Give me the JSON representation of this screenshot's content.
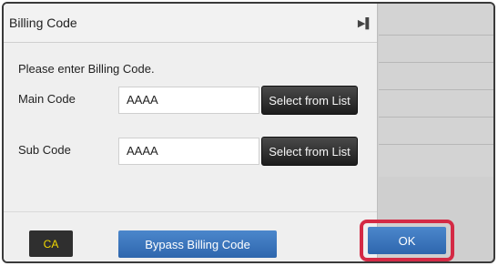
{
  "dialog": {
    "title": "Billing Code",
    "instruction": "Please enter Billing Code.",
    "main_code": {
      "label": "Main Code",
      "value": "AAAA",
      "button": "Select from List"
    },
    "sub_code": {
      "label": "Sub Code",
      "value": "AAAA",
      "button": "Select from List"
    }
  },
  "footer": {
    "ca_label": "CA",
    "bypass_label": "Bypass Billing Code",
    "ok_label": "OK"
  },
  "icons": {
    "expand": "expand-right-icon"
  },
  "colors": {
    "ok_highlight": "#d42a45",
    "primary_blue": "#2e66ad",
    "ca_text": "#f2d800"
  }
}
